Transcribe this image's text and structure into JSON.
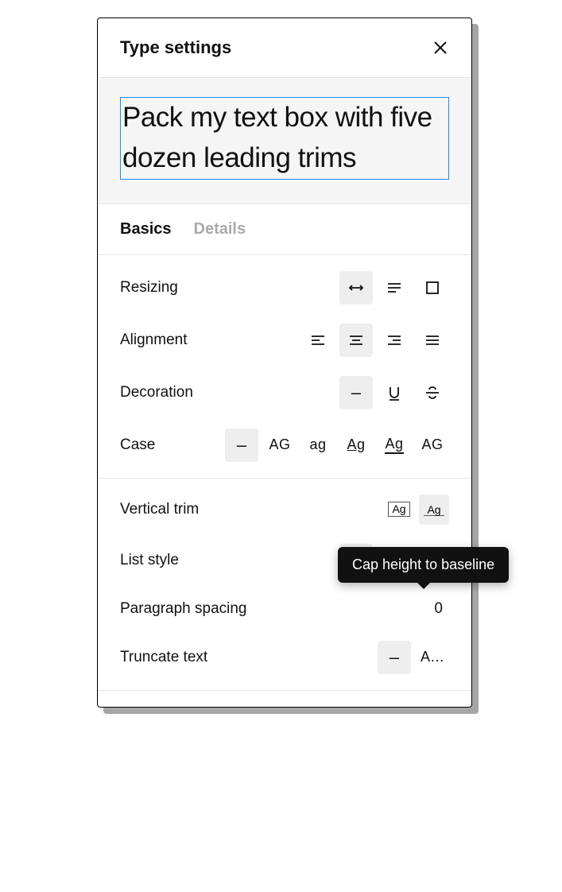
{
  "header": {
    "title": "Type settings"
  },
  "preview": {
    "text": "Pack my text box with five dozen leading trims"
  },
  "tabs": {
    "basics": "Basics",
    "details": "Details"
  },
  "rows": {
    "resizing": {
      "label": "Resizing",
      "options": [
        "auto-width",
        "auto-height",
        "fixed"
      ],
      "selected": "auto-width"
    },
    "alignment": {
      "label": "Alignment",
      "options": [
        "left",
        "center",
        "right",
        "justify"
      ],
      "selected": "center"
    },
    "decoration": {
      "label": "Decoration",
      "options": [
        "none",
        "underline",
        "strikethrough"
      ],
      "selected": "none",
      "none_label": "–"
    },
    "case": {
      "label": "Case",
      "options": [
        "none",
        "upper",
        "lower",
        "title",
        "forced-title",
        "small-caps"
      ],
      "selected": "none",
      "none_label": "–",
      "upper_label": "AG",
      "lower_label": "ag",
      "title_label": "Ag",
      "forced_label": "Ag",
      "smallcaps_label": "AG"
    },
    "vertical_trim": {
      "label": "Vertical trim",
      "options": [
        "standard",
        "cap-height-to-baseline"
      ],
      "selected": "cap-height-to-baseline",
      "sample": "Ag"
    },
    "list_style": {
      "label": "List style",
      "options": [
        "none",
        "bulleted",
        "numbered"
      ],
      "selected": "none",
      "none_label": "–"
    },
    "paragraph_spacing": {
      "label": "Paragraph spacing",
      "value": "0"
    },
    "truncate": {
      "label": "Truncate text",
      "options": [
        "none",
        "ellipsis"
      ],
      "selected": "none",
      "none_label": "–",
      "sample": "A…"
    }
  },
  "tooltip": "Cap height to baseline"
}
